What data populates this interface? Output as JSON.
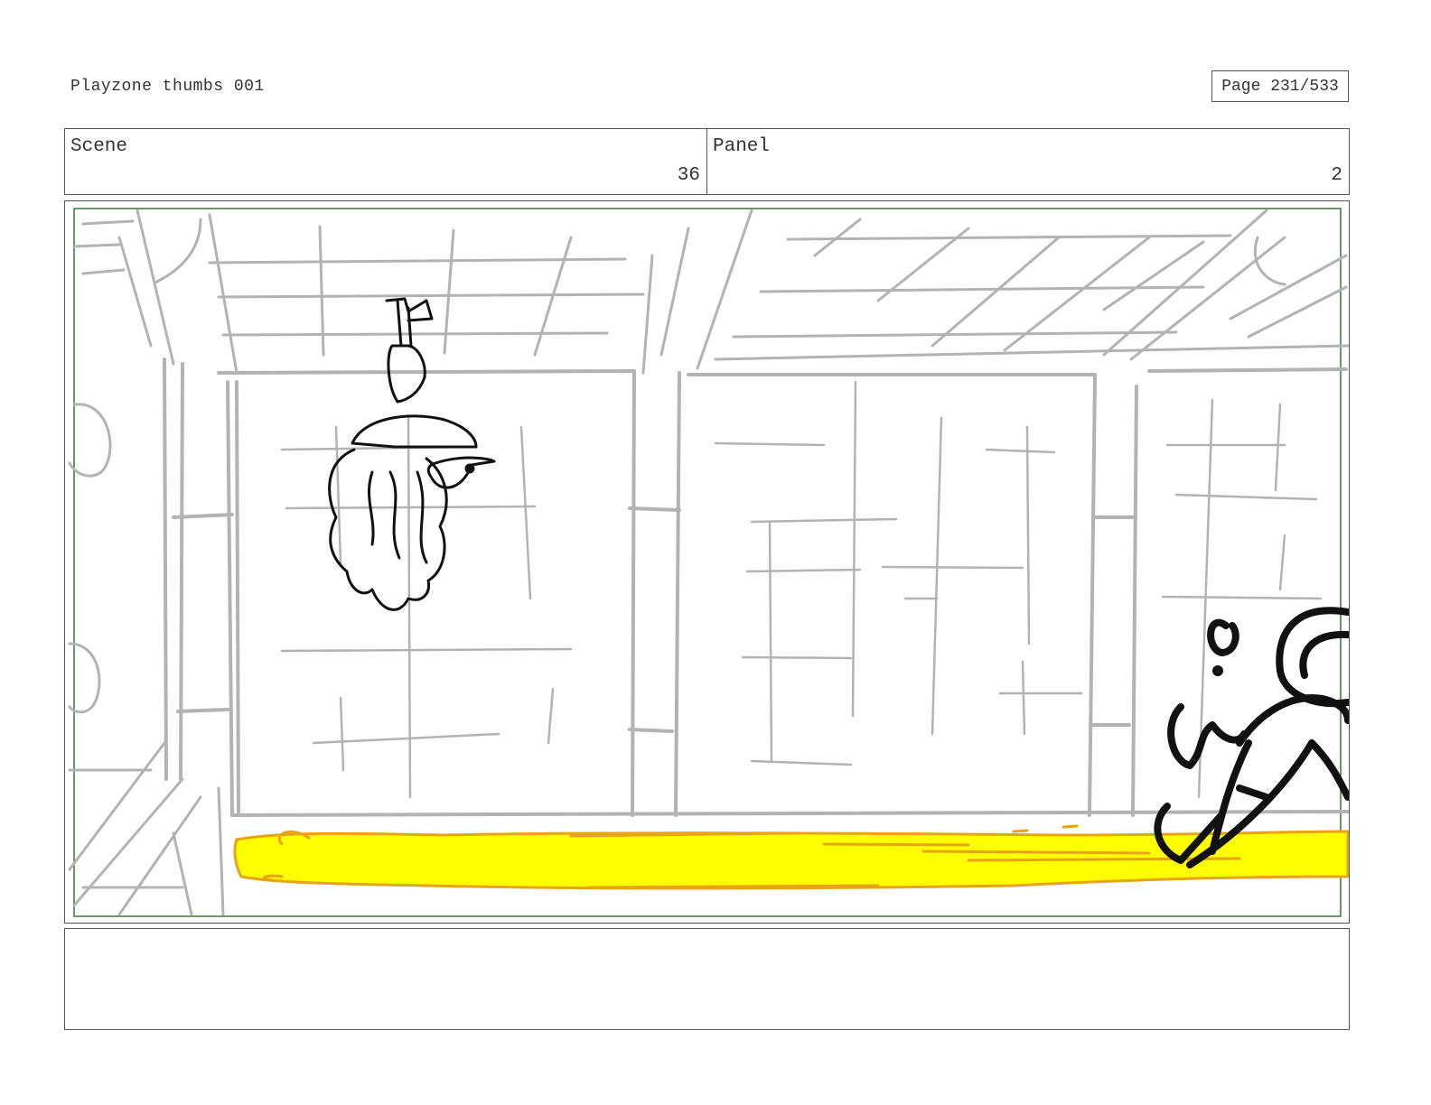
{
  "document": {
    "title": "Playzone thumbs 001",
    "page_label": "Page 231/533"
  },
  "info": {
    "scene_label": "Scene",
    "scene_value": "36",
    "panel_label": "Panel",
    "panel_value": "2"
  },
  "notes": {
    "text": ""
  },
  "colors": {
    "sketch_line": "#b3b3b3",
    "ink_line": "#111111",
    "safe_frame": "#2e7d32",
    "liquid_fill": "#ffff00",
    "liquid_edge": "#e8a317"
  }
}
